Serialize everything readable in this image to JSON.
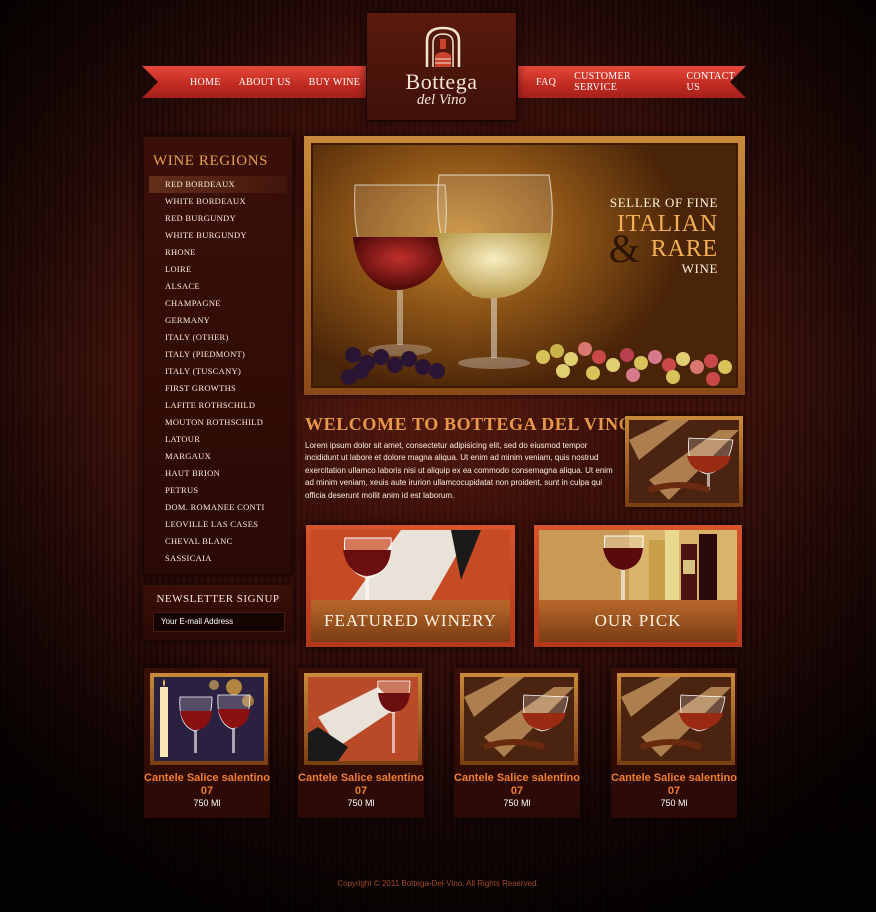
{
  "nav": {
    "left": [
      "Home",
      "About Us",
      "Buy Wine"
    ],
    "right": [
      "Faq",
      "Customer Service",
      "Contact Us"
    ]
  },
  "logo": {
    "title": "Bottega",
    "subtitle": "del Vino"
  },
  "sidebar": {
    "title": "Wine Regions",
    "active_index": 0,
    "items": [
      "Red Bordeaux",
      "White Bordeaux",
      "Red Burgundy",
      "White Burgundy",
      "Rhone",
      "Loire",
      "Alsace",
      "Champagne",
      "Germany",
      "Italy (other)",
      "Italy (Piedmont)",
      "Italy (Tuscany)",
      "First Growths",
      "Lafite Rothschild",
      "Mouton Rothschild",
      "Latour",
      "Margaux",
      "Haut Brion",
      "Petrus",
      "Dom. Romanee Conti",
      "Leoville Las Cases",
      "Cheval Blanc",
      "Sassicaia"
    ]
  },
  "newsletter": {
    "title": "Newsletter Signup",
    "placeholder": "Your E-mail Address"
  },
  "hero": {
    "line1": "Seller of Fine",
    "line2": "Italian",
    "amp": "&",
    "line3": "Rare",
    "line4": "Wine"
  },
  "welcome": {
    "title": "Welcome to Bottega del Vino",
    "body": "Lorem ipsum dolor sit amet, consectetur adipisicing elit, sed do eiusmod tempor incididunt ut labore et dolore magna aliqua. Ut enim ad minim veniam, quis nostrud exercitation ullamco laboris nisi ut aliquip ex ea commodo consemagna aliqua. Ut enim ad minim veniam, xeuis aute irurion ullamcocupidatat non proident, sunt in culpa qui officia deserunt mollit anim id est laborum."
  },
  "features": {
    "featured": "Featured Winery",
    "pick": "Our Pick"
  },
  "products": [
    {
      "name": "Cantele Salice salentino 07",
      "size": "750 Ml"
    },
    {
      "name": "Cantele Salice salentino 07",
      "size": "750 Ml"
    },
    {
      "name": "Cantele Salice salentino 07",
      "size": "750 Ml"
    },
    {
      "name": "Cantele Salice salentino 07",
      "size": "750 Ml"
    }
  ],
  "footer": "Copyright © 2011 Bottega-Del-Vino. All Rights Reserved."
}
